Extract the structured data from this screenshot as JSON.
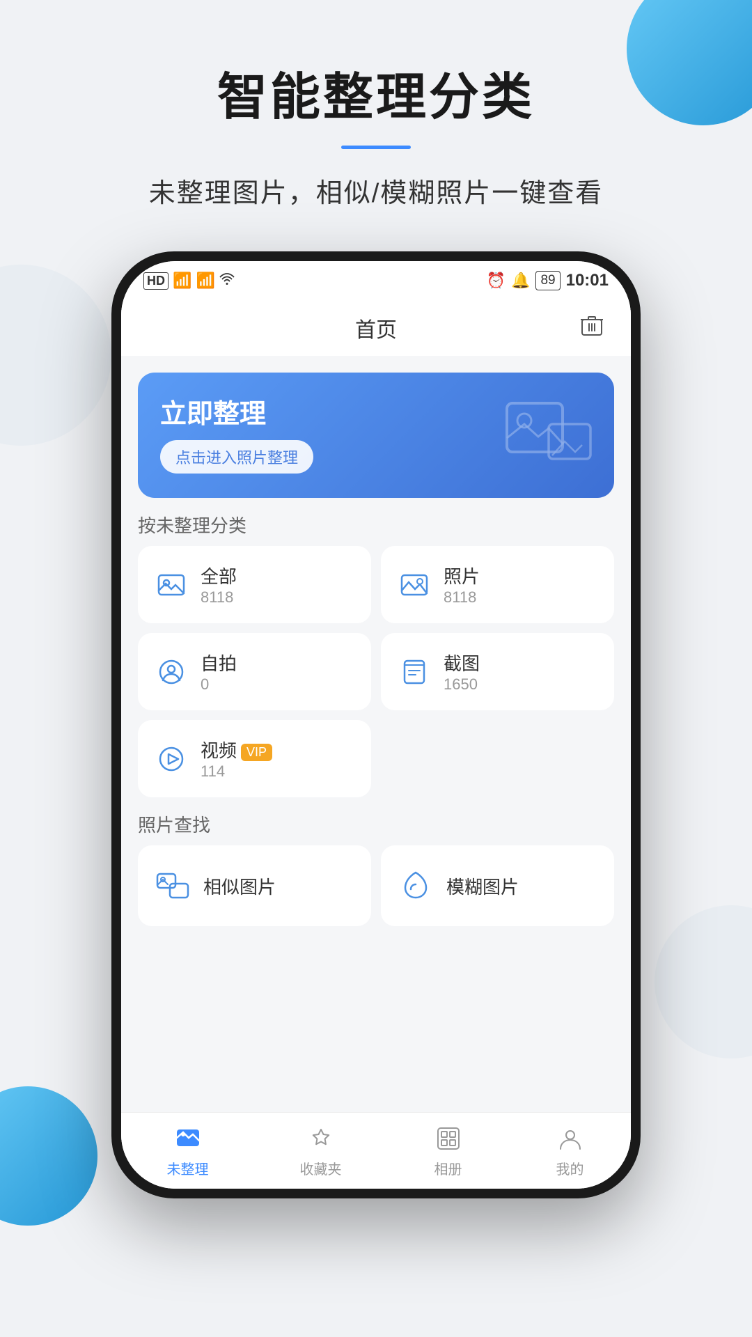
{
  "page": {
    "background_color": "#f0f2f5",
    "title": "智能整理分类",
    "subtitle": "未整理图片，相似/模糊照片一键查看"
  },
  "status_bar": {
    "left_icons": "HD 4G 4G WiFi",
    "time": "10:01",
    "battery": "89"
  },
  "app": {
    "nav_title": "首页",
    "nav_trash_label": "trash",
    "banner": {
      "title": "立即整理",
      "button": "点击进入照片整理"
    },
    "unorganized_section_label": "按未整理分类",
    "categories": [
      {
        "name": "全部",
        "count": "8118",
        "icon": "all-photos-icon"
      },
      {
        "name": "照片",
        "count": "8118",
        "icon": "photos-icon"
      },
      {
        "name": "自拍",
        "count": "0",
        "icon": "selfie-icon"
      },
      {
        "name": "截图",
        "count": "1650",
        "icon": "screenshot-icon"
      },
      {
        "name": "视频",
        "count": "114",
        "icon": "video-icon",
        "vip": true
      }
    ],
    "find_section_label": "照片查找",
    "find_items": [
      {
        "name": "相似图片",
        "icon": "similar-icon"
      },
      {
        "name": "模糊图片",
        "icon": "blur-icon"
      }
    ],
    "tabs": [
      {
        "label": "未整理",
        "icon": "unorganized-tab-icon",
        "active": true
      },
      {
        "label": "收藏夹",
        "icon": "favorites-tab-icon",
        "active": false
      },
      {
        "label": "相册",
        "icon": "album-tab-icon",
        "active": false
      },
      {
        "label": "我的",
        "icon": "profile-tab-icon",
        "active": false
      }
    ]
  }
}
